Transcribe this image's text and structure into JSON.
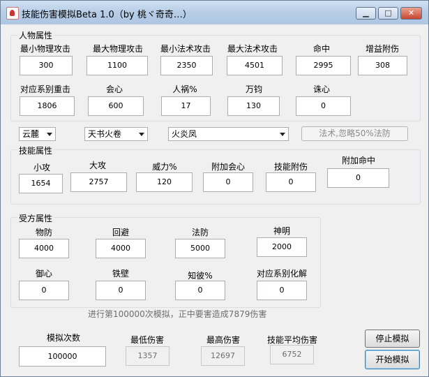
{
  "window": {
    "title": "技能伤害模拟Beta 1.0（by 桃ヾ奇奇…）"
  },
  "character": {
    "section_label": "人物属性",
    "min_phys_attack": {
      "label": "最小物理攻击",
      "value": "300"
    },
    "max_phys_attack": {
      "label": "最大物理攻击",
      "value": "1100"
    },
    "min_magic_attack": {
      "label": "最小法术攻击",
      "value": "2350"
    },
    "max_magic_attack": {
      "label": "最大法术攻击",
      "value": "4501"
    },
    "hit": {
      "label": "命中",
      "value": "2995"
    },
    "buff_bonus_damage": {
      "label": "增益附伤",
      "value": "308"
    },
    "series_crit": {
      "label": "对应系别重击",
      "value": "1806"
    },
    "insight": {
      "label": "会心",
      "value": "600"
    },
    "calamity_pct": {
      "label": "人祸%",
      "value": "17"
    },
    "wanjun": {
      "label": "万钧",
      "value": "130"
    },
    "zhuxin": {
      "label": "诛心",
      "value": "0"
    }
  },
  "selectors": {
    "school": "云麓",
    "skill_book": "天书火卷",
    "skill": "火炎凤",
    "mode_button": "法术,忽略50%法防"
  },
  "skill_attrs": {
    "section_label": "技能属性",
    "small_attack": {
      "label": "小攻",
      "value": "1654"
    },
    "big_attack": {
      "label": "大攻",
      "value": "2757"
    },
    "power_pct": {
      "label": "威力%",
      "value": "120"
    },
    "extra_insight": {
      "label": "附加会心",
      "value": "0"
    },
    "skill_bonus_damage": {
      "label": "技能附伤",
      "value": "0"
    },
    "extra_hit": {
      "label": "附加命中",
      "value": "0"
    }
  },
  "target": {
    "section_label": "受方属性",
    "phys_defense": {
      "label": "物防",
      "value": "4000"
    },
    "dodge": {
      "label": "回避",
      "value": "4000"
    },
    "magic_defense": {
      "label": "法防",
      "value": "5000"
    },
    "divine": {
      "label": "神明",
      "value": "2000"
    },
    "resist_insight": {
      "label": "御心",
      "value": "0"
    },
    "iron_wall": {
      "label": "铁壁",
      "value": "0"
    },
    "zhibi_pct": {
      "label": "知彼%",
      "value": "0"
    },
    "series_resist": {
      "label": "对应系别化解",
      "value": "0"
    }
  },
  "status_text": "进行第100000次模拟，正中要害造成7879伤害",
  "simulation": {
    "count": {
      "label": "模拟次数",
      "value": "100000"
    },
    "min_damage": {
      "label": "最低伤害",
      "value": "1357"
    },
    "max_damage": {
      "label": "最高伤害",
      "value": "12697"
    },
    "avg_damage": {
      "label": "技能平均伤害",
      "value": "6752"
    },
    "stop_button": "停止模拟",
    "start_button": "开始模拟"
  }
}
